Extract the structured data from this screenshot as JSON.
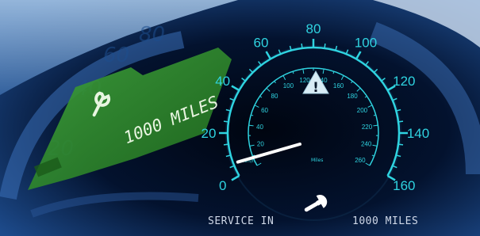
{
  "speedometer": {
    "mph_ticks": [
      "0",
      "20",
      "40",
      "60",
      "80",
      "100",
      "120",
      "140",
      "160"
    ],
    "kmh_ticks": [
      "20",
      "40",
      "60",
      "80",
      "100",
      "120",
      "140",
      "160",
      "180",
      "200",
      "220",
      "240",
      "260"
    ],
    "kmh_unit": "Km/h",
    "mph_unit": "Miles",
    "needle_value_mph": 6,
    "colors": {
      "dial": "#2fd3e0",
      "needle": "#ffffff",
      "background": "#000814"
    }
  },
  "warning": {
    "icon": "warning-triangle-icon",
    "symbol": "!"
  },
  "service_message": {
    "left_text": "SERVICE IN",
    "right_text": "1000 MILES",
    "wrench_icon": "wrench-icon"
  },
  "background_display": {
    "green_panel_text": "1000 MILES",
    "green_panel_color": "#2b8a2a",
    "background_ticks": [
      "20",
      "40",
      "60",
      "80"
    ]
  }
}
